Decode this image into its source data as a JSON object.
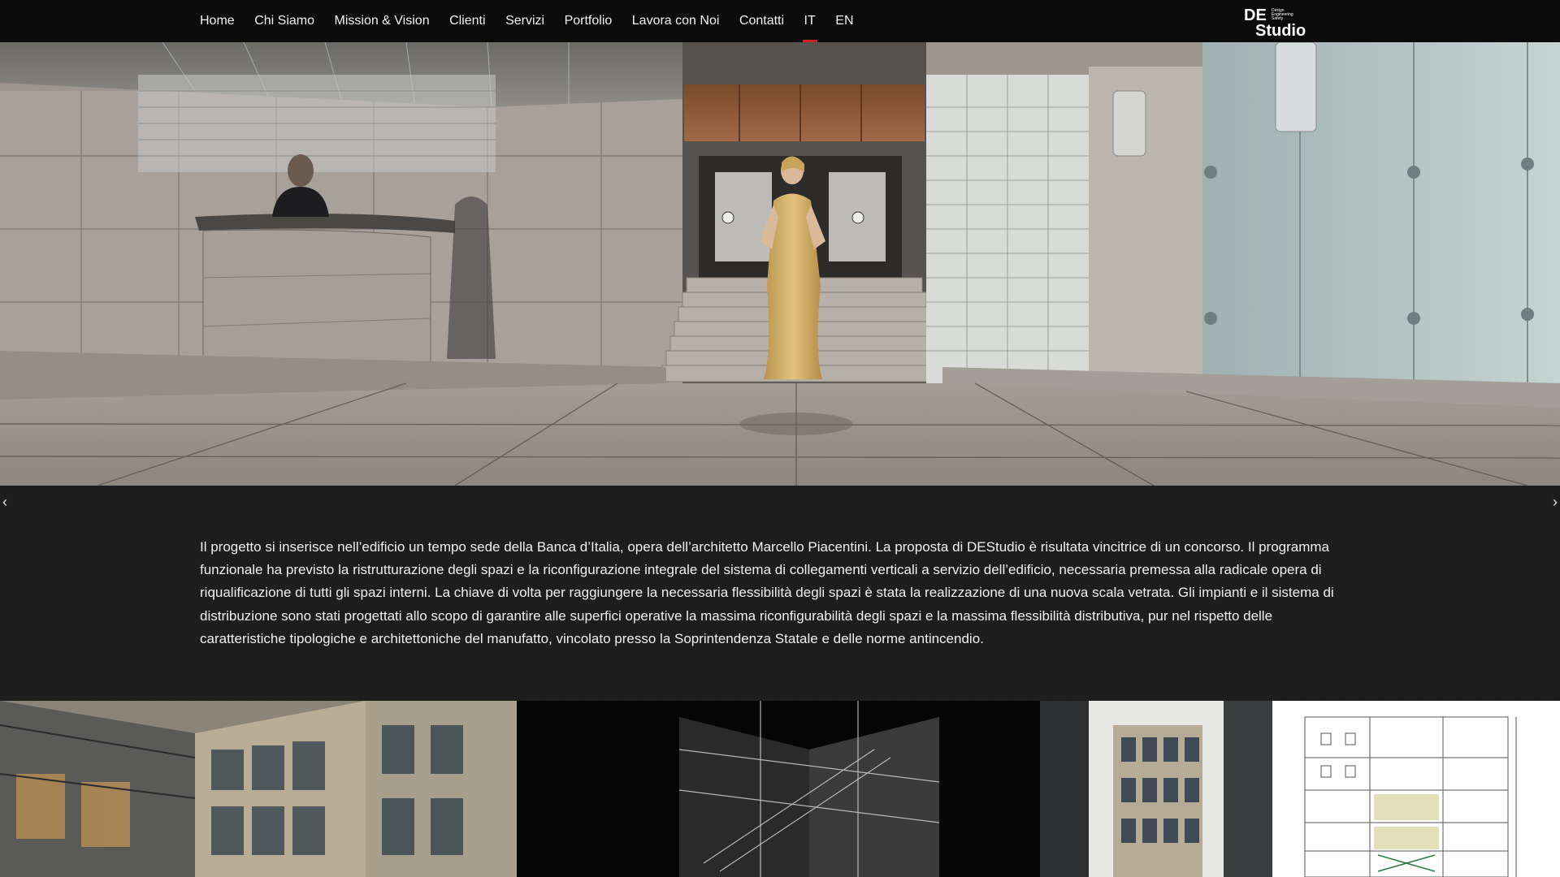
{
  "nav": {
    "items": [
      {
        "label": "Home"
      },
      {
        "label": "Chi Siamo"
      },
      {
        "label": "Mission & Vision"
      },
      {
        "label": "Clienti"
      },
      {
        "label": "Servizi"
      },
      {
        "label": "Portfolio"
      },
      {
        "label": "Lavora con Noi"
      },
      {
        "label": "Contatti"
      },
      {
        "label": "IT"
      },
      {
        "label": "EN"
      }
    ],
    "active_index": 8
  },
  "logo": {
    "mark": "DE",
    "line1": "Design",
    "line2": "Engineering",
    "line3": "Safety",
    "word": "Studio"
  },
  "slider": {
    "prev_icon": "chevron-left-icon",
    "next_icon": "chevron-right-icon",
    "prev_glyph": "‹",
    "next_glyph": "›"
  },
  "project": {
    "description": "Il progetto si inserisce nell’edificio un tempo sede della Banca d’Italia, opera dell’architetto Marcello Piacentini. La proposta di DEStudio è risultata vincitrice di un concorso. Il programma funzionale ha previsto la ristrutturazione degli spazi e la riconfigurazione integrale del sistema di collegamenti verticali a servizio dell’edificio, necessaria premessa alla radicale opera di riqualificazione di tutti gli spazi interni.  La chiave di volta per raggiungere la necessaria flessibilità degli spazi è stata la realizzazione di una nuova scala vetrata. Gli impianti e il sistema di distribuzione sono stati progettati allo scopo di garantire alle superfici operative la massima riconfigurabilità degli spazi e la massima flessibilità distributiva, pur nel rispetto delle caratteristiche tipologiche e architettoniche del manufatto, vincolato presso la Soprintendenza Statale e delle norme antincendio."
  },
  "colors": {
    "topbar": "#0b0b0b",
    "band": "#1c1c1c",
    "accent": "#d0202a",
    "text": "#f0f0f0"
  }
}
